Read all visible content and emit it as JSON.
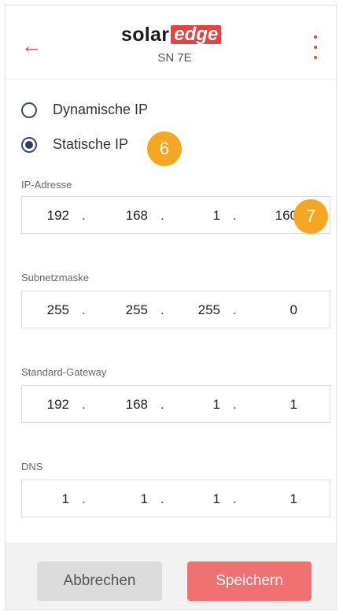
{
  "header": {
    "logo_solar": "solar",
    "logo_edge": "edge",
    "serial": "SN 7E",
    "back_icon": "arrow-left-icon",
    "menu_icon": "more-vertical-icon"
  },
  "ip_mode": {
    "options": [
      {
        "label": "Dynamische IP",
        "selected": false
      },
      {
        "label": "Statische IP",
        "selected": true
      }
    ]
  },
  "badges": [
    "6",
    "7"
  ],
  "fields": [
    {
      "label": "IP-Adresse",
      "octets": [
        "192",
        "168",
        "1",
        "160"
      ]
    },
    {
      "label": "Subnetzmaske",
      "octets": [
        "255",
        "255",
        "255",
        "0"
      ]
    },
    {
      "label": "Standard-Gateway",
      "octets": [
        "192",
        "168",
        "1",
        "1"
      ]
    },
    {
      "label": "DNS",
      "octets": [
        "1",
        "1",
        "1",
        "1"
      ]
    }
  ],
  "footer": {
    "cancel_label": "Abbrechen",
    "save_label": "Speichern"
  },
  "colors": {
    "accent": "#e8413e",
    "badge": "#f5a623",
    "save_button": "#f07171"
  }
}
